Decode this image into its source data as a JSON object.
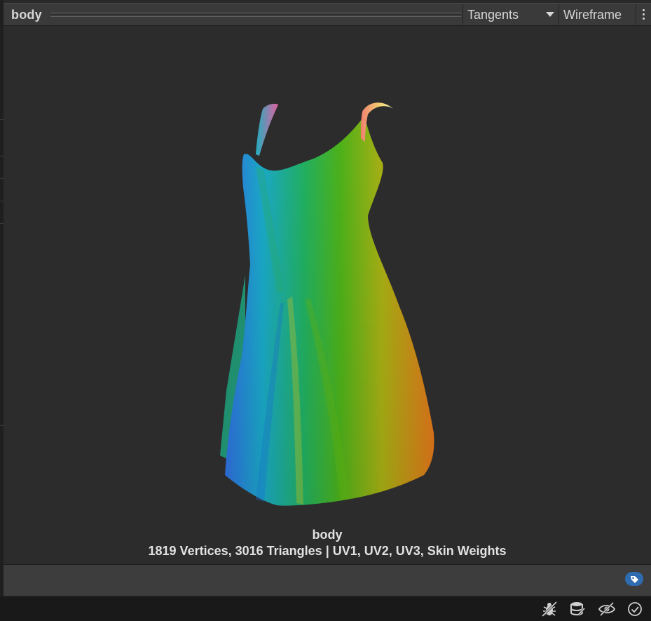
{
  "header": {
    "title": "body",
    "shading_mode": "Tangents",
    "wireframe_label": "Wireframe",
    "more_icon": "kebab-menu-icon"
  },
  "preview": {
    "mesh_name": "body",
    "mesh_info": "1819 Vertices, 3016 Triangles | UV1, UV2, UV3, Skin Weights",
    "background_color": "#2c2c2c"
  },
  "label_bar": {
    "tag_icon": "asset-label-tag-icon",
    "tag_color": "#2f6bb0"
  },
  "status_bar": {
    "icons": [
      "debug-bug-icon",
      "cache-server-icon",
      "hidden-visibility-icon",
      "check-circle-icon"
    ]
  }
}
